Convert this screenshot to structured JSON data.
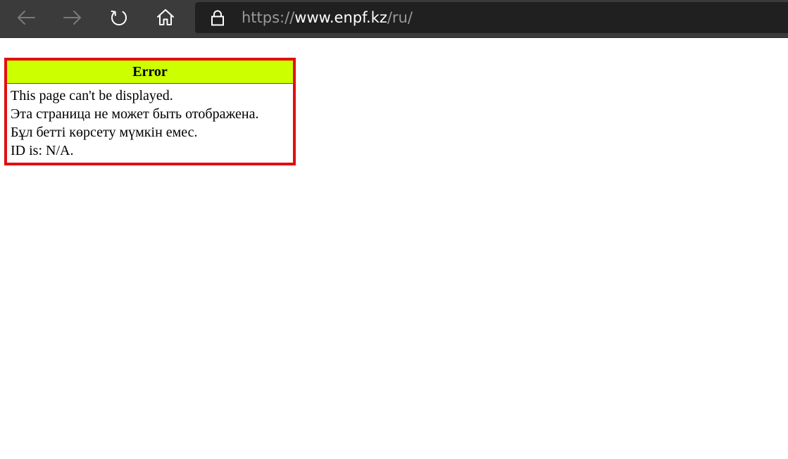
{
  "browser": {
    "url": {
      "scheme": "https://",
      "host": "www.enpf.kz",
      "path": "/ru/"
    },
    "icons": {
      "back": "arrow-left-icon",
      "forward": "arrow-right-icon",
      "reload": "reload-icon",
      "home": "home-icon",
      "lock": "lock-icon"
    },
    "colors": {
      "toolbar": "#3b3b3b",
      "address_bar": "#202020",
      "icon_disabled": "#7a7a7a",
      "icon_active": "#ffffff"
    }
  },
  "error": {
    "title": "Error",
    "lines": [
      "This page can't be displayed.",
      "Эта страница не может быть отображена.",
      "Бұл бетті көрсету мүмкін емес.",
      "ID is: N/A."
    ],
    "colors": {
      "border": "#e10f0f",
      "header_bg": "#ccff00"
    }
  }
}
